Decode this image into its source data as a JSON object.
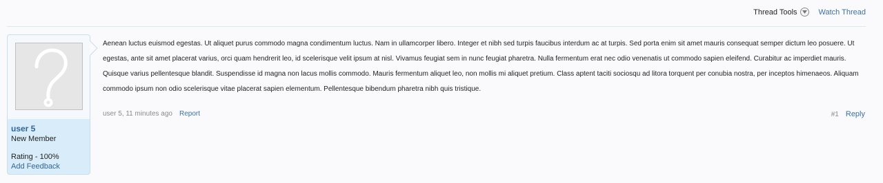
{
  "toolbar": {
    "thread_tools_label": "Thread Tools",
    "thread_tools_icon": "chevron-down-circle-icon",
    "watch_thread_label": "Watch Thread"
  },
  "user": {
    "avatar_icon": "question-mark-icon",
    "name": "user 5",
    "title": "New Member",
    "rating": "Rating - 100%",
    "add_feedback": "Add Feedback"
  },
  "post": {
    "body": "Aenean luctus euismod egestas. Ut aliquet purus commodo magna condimentum luctus. Nam in ullamcorper libero. Integer et nibh sed turpis faucibus interdum ac at turpis. Sed porta enim sit amet mauris consequat semper dictum leo posuere. Ut egestas, ante sit amet placerat varius, orci quam hendrerit leo, id scelerisque velit ipsum at nisl. Vivamus feugiat sem in nunc feugiat pharetra. Nulla fermentum erat nec odio venenatis ut commodo sapien eleifend. Curabitur ac imperdiet mauris. Quisque varius pellentesque blandit. Suspendisse id magna non lacus mollis commodo. Mauris fermentum aliquet leo, non mollis mi aliquet pretium. Class aptent taciti sociosqu ad litora torquent per conubia nostra, per inceptos himenaeos. Aliquam commodo ipsum non odio scelerisque vitae placerat sapien elementum. Pellentesque bibendum pharetra nibh quis tristique.",
    "meta": "user 5, 11 minutes ago",
    "report_label": "Report",
    "post_number": "#1",
    "reply_label": "Reply"
  },
  "colors": {
    "link": "#3a70a8",
    "user_card_bg": "#d9ecf9"
  }
}
